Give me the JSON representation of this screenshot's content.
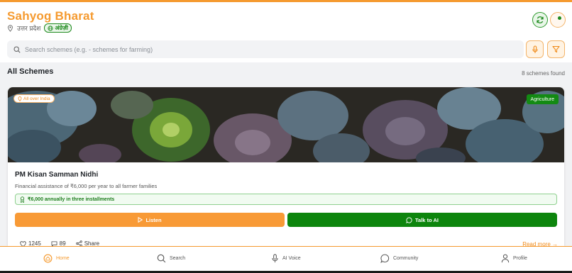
{
  "header": {
    "app_title": "Sahyog Bharat",
    "location": "उत्तर प्रदेश",
    "language_badge": "अंग्रेज़ी"
  },
  "search": {
    "placeholder": "Search schemes (e.g. - schemes for farming)"
  },
  "section": {
    "title": "All Schemes",
    "count_text": "8 schemes found"
  },
  "card": {
    "region_badge": "All over India",
    "category": "Agriculture",
    "title": "PM Kisan Samman Nidhi",
    "description": "Financial assistance of ₹6,000 per year to all farmer families",
    "benefit": "₹6,000 annually in three installments",
    "listen_label": "Listen",
    "talk_label": "Talk to AI",
    "likes": "1245",
    "comments": "89",
    "share_label": "Share",
    "read_more": "Read more →"
  },
  "nav": {
    "items": [
      {
        "label": "Home",
        "icon": "home-icon",
        "active": true
      },
      {
        "label": "Search",
        "icon": "search-icon"
      },
      {
        "label": "AI Voice",
        "icon": "mic-icon"
      },
      {
        "label": "Community",
        "icon": "chat-icon"
      },
      {
        "label": "Profile",
        "icon": "user-icon"
      }
    ]
  },
  "colors": {
    "brand_orange": "#f59a2f",
    "brand_green": "#0d850d",
    "background": "#f1f2f4"
  }
}
